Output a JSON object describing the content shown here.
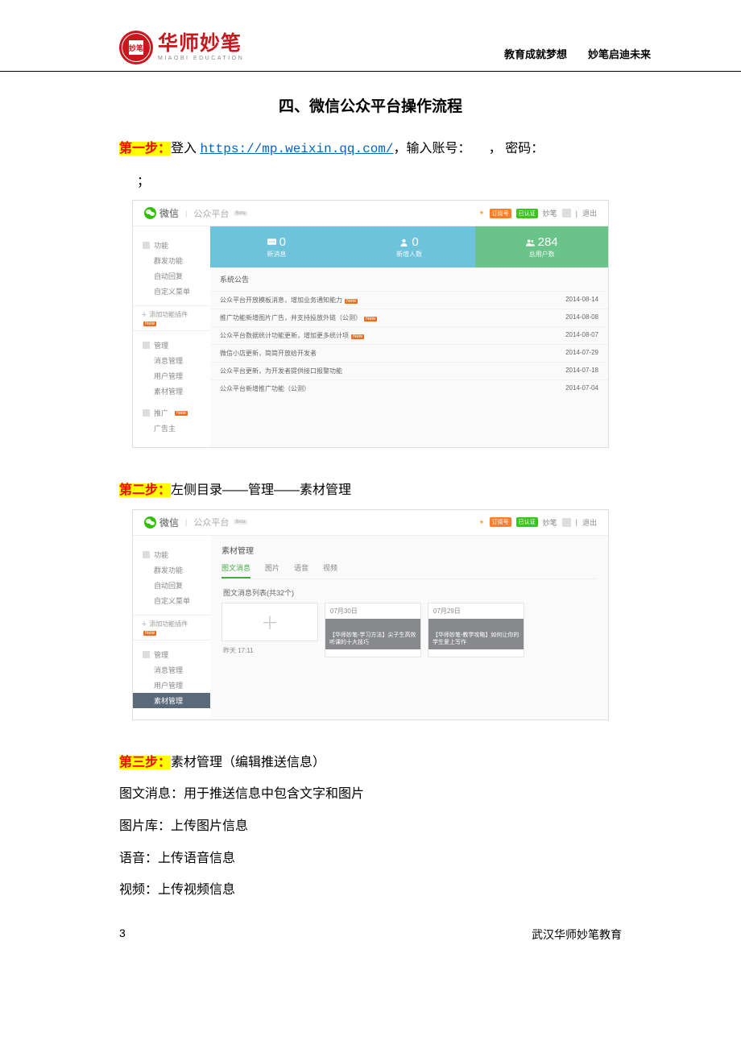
{
  "header": {
    "brand_cn": "华师妙笔",
    "brand_en": "MIAOBI EDUCATION",
    "seal_text": "妙笔",
    "slogan_a": "教育成就梦想",
    "slogan_b": "妙笔启迪未来"
  },
  "title": "四、微信公众平台操作流程",
  "step1": {
    "badge": "第一步：",
    "t1": "登入 ",
    "url": "https://mp.weixin.qq.com/",
    "t2": "，输入账号：",
    "t3": "， 密码：",
    "t4": "；"
  },
  "step2": {
    "badge": "第二步：",
    "text": "左侧目录——管理——素材管理"
  },
  "step3": {
    "badge": "第三步：",
    "text": "素材管理（编辑推送信息）",
    "l1": "图文消息：用于推送信息中包含文字和图片",
    "l2": "图片库：上传图片信息",
    "l3": "语音：上传语音信息",
    "l4": "视频：上传视频信息"
  },
  "ss": {
    "wx": "微信",
    "pf": "公众平台",
    "beta": "Beta",
    "acct": "妙笔",
    "badge1": "订阅号",
    "badge2": "已认证",
    "logout": "退出",
    "side": {
      "fn": "功能",
      "fn_items": [
        "群发功能",
        "自动回复",
        "自定义菜单"
      ],
      "plugin": "＋ 添加功能插件",
      "mg": "管理",
      "mg_items": [
        "消息管理",
        "用户管理",
        "素材管理"
      ],
      "pr": "推广",
      "pr_items": [
        "广告主"
      ]
    },
    "new": "New",
    "stats": [
      {
        "n": "0",
        "l": "新消息"
      },
      {
        "n": "0",
        "l": "新增人数"
      },
      {
        "n": "284",
        "l": "总用户数"
      }
    ],
    "ann_h": "系统公告",
    "ann": [
      {
        "t": "公众平台开放模板消息，增加业务通知能力",
        "d": "2014-08-14",
        "n": true
      },
      {
        "t": "推广功能新增图片广告，并支持投放外链（公测）",
        "d": "2014-08-08",
        "n": true
      },
      {
        "t": "公众平台数据统计功能更新，增加更多统计项",
        "d": "2014-08-07",
        "n": true
      },
      {
        "t": "微信小店更新，简简开放给开发者",
        "d": "2014-07-29",
        "n": false
      },
      {
        "t": "公众平台更新，为开发者提供接口报警功能",
        "d": "2014-07-18",
        "n": false
      },
      {
        "t": "公众平台新增推广功能（公测）",
        "d": "2014-07-04",
        "n": false
      }
    ],
    "sm": {
      "title": "素材管理",
      "tabs": [
        "图文消息",
        "图片",
        "语音",
        "视频"
      ],
      "list_h": "图文消息列表(共32个)",
      "time1": "昨天 17:11",
      "cards": [
        {
          "date": "07月30日",
          "cap": "【华师妙笔-学习方法】尖子生高效听课的十大技巧"
        },
        {
          "date": "07月29日",
          "cap": "【华师妙笔-教学攻略】如何让你的学生爱上写作"
        }
      ]
    }
  },
  "footer": {
    "page": "3",
    "org": "武汉华师妙笔教育"
  }
}
